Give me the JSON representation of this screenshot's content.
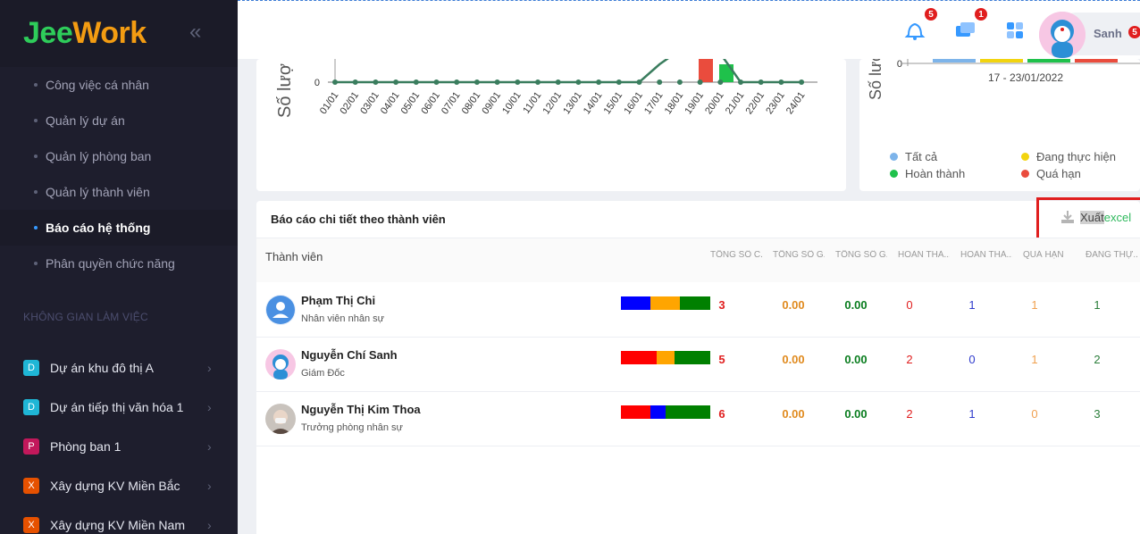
{
  "sidebar": {
    "logo_part1": "Jee",
    "logo_part2": "Work",
    "menu": [
      {
        "label": "Công việc cá nhân"
      },
      {
        "label": "Quản lý dự án"
      },
      {
        "label": "Quản lý phòng ban"
      },
      {
        "label": "Quản lý thành viên"
      },
      {
        "label": "Báo cáo hệ thống"
      },
      {
        "label": "Phân quyền chức năng"
      }
    ],
    "section_label": "KHÔNG GIAN LÀM VIỆC",
    "workspaces": [
      {
        "badge": "D",
        "label": "Dự án khu đô thị A",
        "color": "#1fb6d6"
      },
      {
        "badge": "D",
        "label": "Dự án tiếp thị văn hóa 1",
        "color": "#1fb6d6"
      },
      {
        "badge": "P",
        "label": "Phòng ban 1",
        "color": "#c2185b"
      },
      {
        "badge": "X",
        "label": "Xây dựng KV Miền Bắc",
        "color": "#e65100"
      },
      {
        "badge": "X",
        "label": "Xây dựng KV Miền Nam",
        "color": "#e65100"
      }
    ]
  },
  "topbar": {
    "bell_count": "5",
    "chat_count": "1",
    "user_name": "Sanh",
    "user_badge": "5"
  },
  "chart_left": {
    "ylabel": "Số lượ",
    "y_tick": "0",
    "x_labels": [
      "01/01",
      "02/01",
      "03/01",
      "04/01",
      "05/01",
      "06/01",
      "07/01",
      "08/01",
      "09/01",
      "10/01",
      "11/01",
      "12/01",
      "13/01",
      "14/01",
      "15/01",
      "16/01",
      "17/01",
      "18/01",
      "19/01",
      "20/01",
      "21/01",
      "22/01",
      "23/01",
      "24/01"
    ]
  },
  "chart_right": {
    "ylabel": "Số lượ",
    "y_tick": "0",
    "x_label": "17 - 23/01/2022",
    "legend": [
      {
        "label": "Tất cả",
        "color": "#7db4ea"
      },
      {
        "label": "Đang thực hiện",
        "color": "#f2d40f"
      },
      {
        "label": "Hoàn thành",
        "color": "#1fc14b"
      },
      {
        "label": "Quá hạn",
        "color": "#ea4c3d"
      }
    ]
  },
  "report": {
    "title": "Báo cáo chi tiết theo thành viên",
    "export_x": "Xuất",
    "export_e": "excel",
    "headers": {
      "member": "Thành viên",
      "c1": "TỔNG SỐ C...",
      "c2": "TỔNG SỐ G...",
      "c3": "TỔNG SỐ G...",
      "c4": "HOÀN THÀ...",
      "c5": "HOÀN THÀ...",
      "c6": "QUÁ HẠN",
      "c7": "ĐANG THỰ..."
    },
    "rows": [
      {
        "name": "Phạm Thị Chi",
        "role": "Nhân viên nhân sự",
        "total": "3",
        "g1": "0.00",
        "g2": "0.00",
        "h1": "0",
        "h2": "1",
        "overdue": "1",
        "doing": "1",
        "bar": [
          {
            "w": 33,
            "c": "#0000ff"
          },
          {
            "w": 33,
            "c": "#ffa500"
          },
          {
            "w": 34,
            "c": "#008000"
          }
        ]
      },
      {
        "name": "Nguyễn Chí Sanh",
        "role": "Giám Đốc",
        "total": "5",
        "g1": "0.00",
        "g2": "0.00",
        "h1": "2",
        "h2": "0",
        "overdue": "1",
        "doing": "2",
        "bar": [
          {
            "w": 40,
            "c": "#ff0000"
          },
          {
            "w": 20,
            "c": "#ffa500"
          },
          {
            "w": 40,
            "c": "#008000"
          }
        ]
      },
      {
        "name": "Nguyễn Thị Kim Thoa",
        "role": "Trưởng phòng nhân sự",
        "total": "6",
        "g1": "0.00",
        "g2": "0.00",
        "h1": "2",
        "h2": "1",
        "overdue": "0",
        "doing": "3",
        "bar": [
          {
            "w": 33,
            "c": "#ff0000"
          },
          {
            "w": 17,
            "c": "#0000ff"
          },
          {
            "w": 50,
            "c": "#008000"
          }
        ]
      }
    ]
  }
}
